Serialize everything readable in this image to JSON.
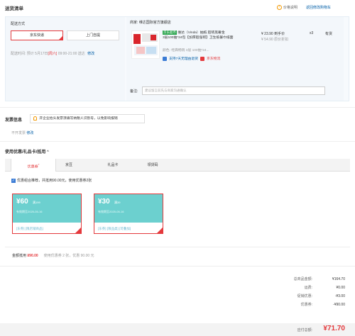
{
  "header": {
    "title": "送货清单",
    "price_note": "价格说明",
    "back_to_cart": "返回修改购物车"
  },
  "shipping": {
    "method_label": "配送方式",
    "options": [
      "京东快递",
      "上门自提"
    ],
    "selected": "京东快递",
    "time_label": "配送时间:",
    "time_text": "预计 5月17日",
    "weekday": "[周六]",
    "time_range": "09:00-21:00 送达",
    "modify": "修改"
  },
  "product": {
    "seller_label": "商家:",
    "seller_name": "维达国际官方旗舰店",
    "badge": "京东超市",
    "title_line1": "维达（Vinda）抽纸 超韧黑奢金",
    "title_line2": "3层100抽*24包【加厚超强韧】卫生纸餐巾纸面巾纸",
    "color_label": "颜色:",
    "color_value": "经典畅销 3层 100抽*24...",
    "price": "¥ 23.90",
    "price_note": "到手价",
    "orig_price": "¥ 54.90",
    "orig_note": "原价折扣",
    "qty": "x3",
    "stock": "有货",
    "service1": "支持7天无理由退货",
    "service2": "京东物流",
    "remark_label": "备注:",
    "remark_placeholder": "建议留言前先与商家沟通确认"
  },
  "invoice": {
    "title": "发票信息",
    "notice": "开企业抬头发票须填写纳税人识别号，以免影响报销",
    "value": "不开发票",
    "modify": "修改"
  },
  "coupons": {
    "title": "使用优惠/礼品卡/抵用",
    "tabs": [
      "优惠券",
      "京豆",
      "礼品卡",
      "领货码"
    ],
    "combo_text": "优惠组合推荐，共抵用90.00元，使用优惠券2张",
    "items": [
      {
        "amount": "¥60",
        "cond": "满199",
        "expiry": "有效期至2025-05-16",
        "tags": "[东券]  [限店铺商品]"
      },
      {
        "amount": "¥30",
        "cond": "满39",
        "expiry": "有效期至2025-05-16",
        "tags": "[东券]  [限品类]  [可叠加]"
      }
    ],
    "summary_label": "金额抵用",
    "summary_amount": "¥90.00",
    "summary_text": "使用优惠券 2 张，优惠 90.00 元"
  },
  "totals": {
    "rows": [
      {
        "label": "总商品金额:",
        "value": "¥164.70"
      },
      {
        "label": "运费:",
        "value": "¥0.00"
      },
      {
        "label": "促销优惠:",
        "value": "-¥3.00"
      },
      {
        "label": "优惠券:",
        "value": "-¥90.00"
      }
    ],
    "pay_label": "应付总额:",
    "pay_value": "¥71.70"
  },
  "colors": {
    "accent": "#e4393c",
    "coupon_teal": "#6cd0cf",
    "link": "#005ea7"
  }
}
